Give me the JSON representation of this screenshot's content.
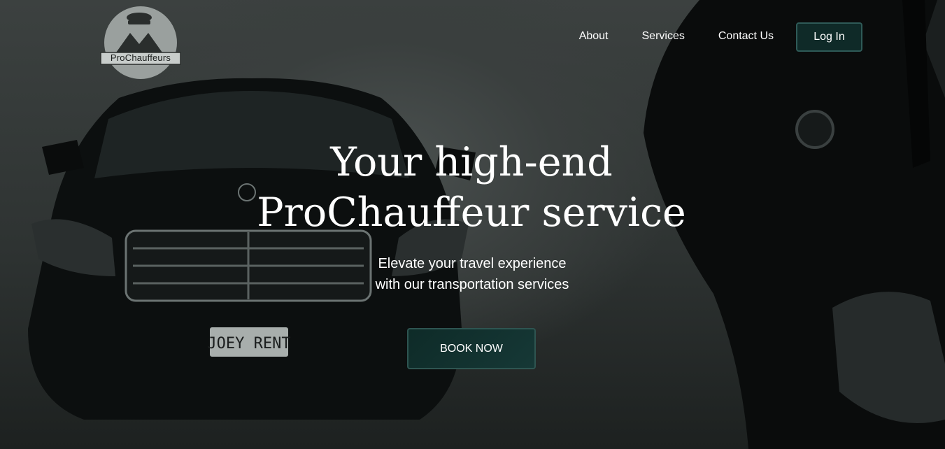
{
  "brand": {
    "name": "ProChauffeurs"
  },
  "nav": {
    "items": [
      "About",
      "Services",
      "Contact Us"
    ],
    "login_label": "Log In"
  },
  "hero": {
    "title_line1": "Your high-end",
    "title_line2": "ProChauffeur service",
    "subtitle_line1": "Elevate your travel experience",
    "subtitle_line2": "with our transportation services",
    "cta_label": "BOOK NOW"
  },
  "background": {
    "plate_text": "JOEY RENT",
    "accent": "#0f2a28",
    "text_color": "#ffffff"
  }
}
